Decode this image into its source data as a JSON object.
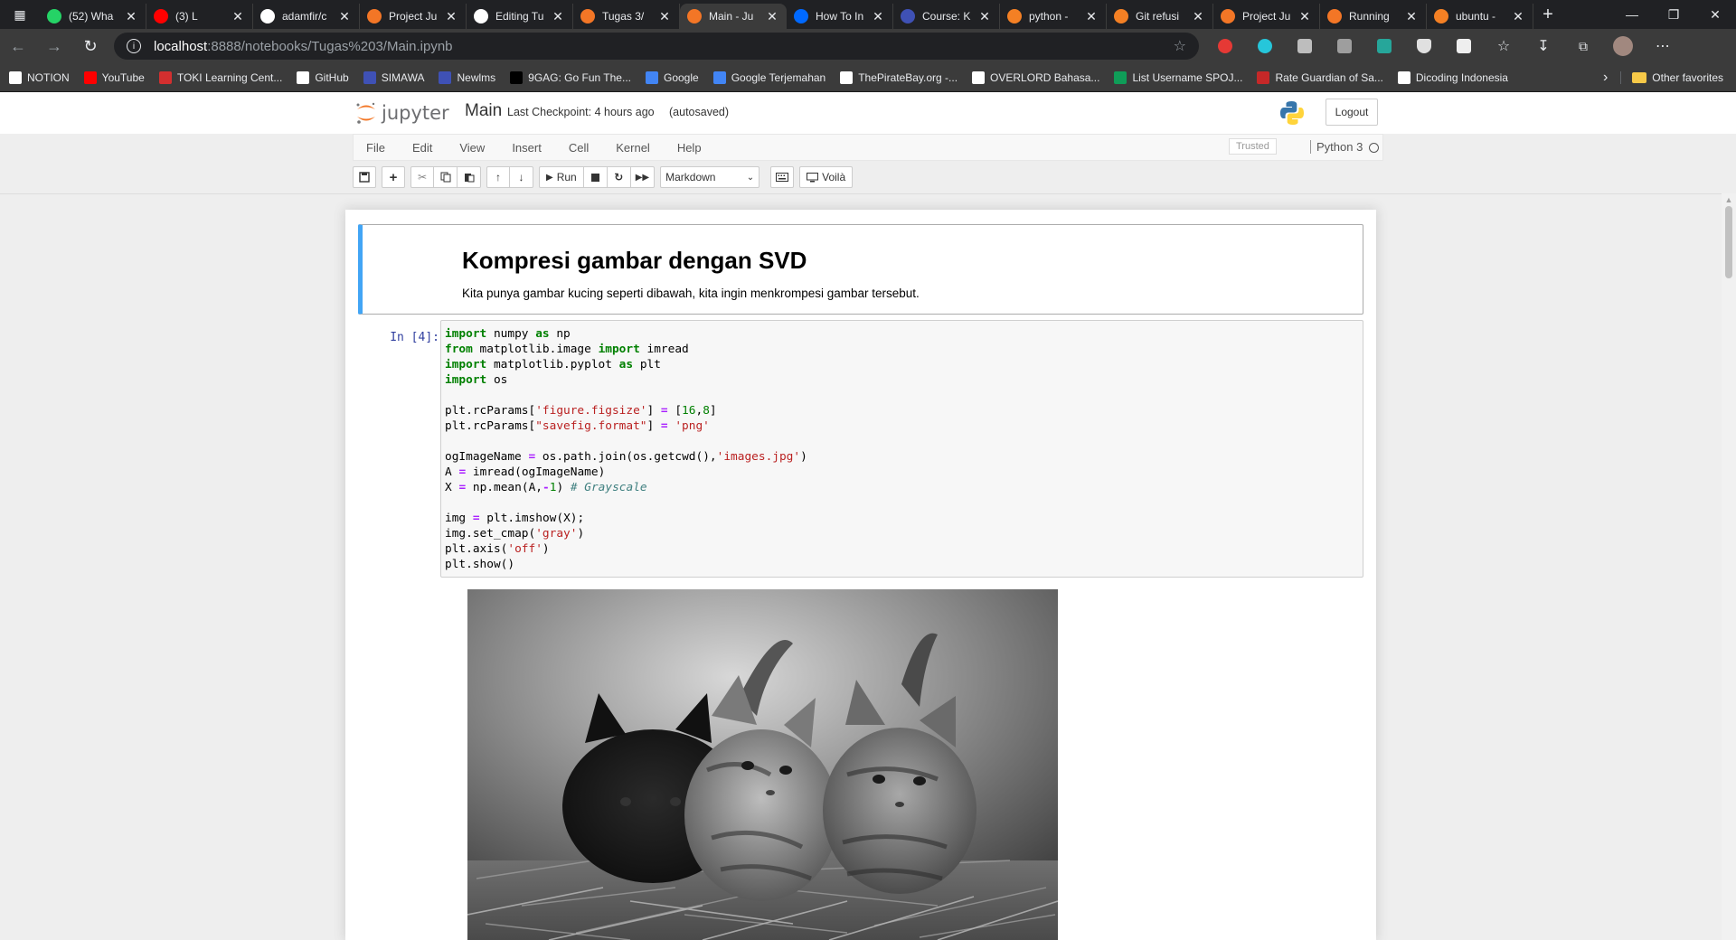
{
  "browser": {
    "tabs": [
      {
        "title": "(52) Wha",
        "icon": "whatsapp-icon",
        "color": "#25d366"
      },
      {
        "title": "(3) L",
        "icon": "youtube-icon",
        "color": "#ff0000"
      },
      {
        "title": "adamfir/c",
        "icon": "github-icon",
        "color": "#ffffff"
      },
      {
        "title": "Project Ju",
        "icon": "jupyter-icon",
        "color": "#f37626"
      },
      {
        "title": "Editing Tu",
        "icon": "github-icon",
        "color": "#ffffff"
      },
      {
        "title": "Tugas 3/",
        "icon": "jupyter-icon",
        "color": "#f37626"
      },
      {
        "title": "Main - Ju",
        "icon": "jupyter-notebook-icon",
        "color": "#f37626"
      },
      {
        "title": "How To In",
        "icon": "digitalocean-icon",
        "color": "#0069ff"
      },
      {
        "title": "Course: K",
        "icon": "course-icon",
        "color": "#3f51b5"
      },
      {
        "title": "python - ",
        "icon": "stackoverflow-icon",
        "color": "#f48024"
      },
      {
        "title": "Git refusi",
        "icon": "stackoverflow-icon",
        "color": "#f48024"
      },
      {
        "title": "Project Ju",
        "icon": "jupyter-icon",
        "color": "#f37626"
      },
      {
        "title": "Running",
        "icon": "jupyter-icon",
        "color": "#f37626"
      },
      {
        "title": "ubuntu - ",
        "icon": "stackoverflow-icon",
        "color": "#f48024"
      }
    ],
    "address": {
      "host": "localhost",
      "path": ":8888/notebooks/Tugas%203/Main.ipynb"
    },
    "bookmarks": [
      {
        "label": "NOTION",
        "color": "#ffffff"
      },
      {
        "label": "YouTube",
        "color": "#ff0000"
      },
      {
        "label": "TOKI Learning Cent...",
        "color": "#d32f2f"
      },
      {
        "label": "GitHub",
        "color": "#ffffff"
      },
      {
        "label": "SIMAWA",
        "color": "#3f51b5"
      },
      {
        "label": "Newlms",
        "color": "#3f51b5"
      },
      {
        "label": "9GAG: Go Fun The...",
        "color": "#000000"
      },
      {
        "label": "Google",
        "color": "#4285f4"
      },
      {
        "label": "Google Terjemahan",
        "color": "#4285f4"
      },
      {
        "label": "ThePirateBay.org -...",
        "color": "#ffffff"
      },
      {
        "label": "OVERLORD Bahasa...",
        "color": "#ffffff"
      },
      {
        "label": "List Username SPOJ...",
        "color": "#0f9d58"
      },
      {
        "label": "Rate Guardian of Sa...",
        "color": "#c62828"
      },
      {
        "label": "Dicoding Indonesia",
        "color": "#ffffff"
      }
    ],
    "other_favorites": "Other favorites"
  },
  "jupyter": {
    "logo_text": "jupyter",
    "notebook_name": "Main",
    "checkpoint": "Last Checkpoint: 4 hours ago",
    "autosaved": "(autosaved)",
    "logout": "Logout",
    "menu": [
      "File",
      "Edit",
      "View",
      "Insert",
      "Cell",
      "Kernel",
      "Help"
    ],
    "trusted": "Trusted",
    "kernel": "Python 3",
    "toolbar": {
      "run_label": "Run",
      "cell_type": "Markdown",
      "voila_label": "Voilà"
    },
    "markdown_cell": {
      "title": "Kompresi gambar dengan SVD",
      "text": "Kita punya gambar kucing seperti dibawah, kita ingin menkrompesi gambar tersebut."
    },
    "code_cell": {
      "prompt": "In [4]:",
      "lines": [
        "import numpy as np",
        "from matplotlib.image import imread",
        "import matplotlib.pyplot as plt",
        "import os",
        "",
        "plt.rcParams['figure.figsize'] = [16,8]",
        "plt.rcParams[\"savefig.format\"] = 'png'",
        "",
        "ogImageName = os.path.join(os.getcwd(),'images.jpg')",
        "A = imread(ogImageName)",
        "X = np.mean(A,-1) # Grayscale",
        "",
        "img = plt.imshow(X);",
        "img.set_cmap('gray')",
        "plt.axis('off')",
        "plt.show()"
      ]
    },
    "output_image": "grayscale photo of three kittens lying on straw"
  }
}
